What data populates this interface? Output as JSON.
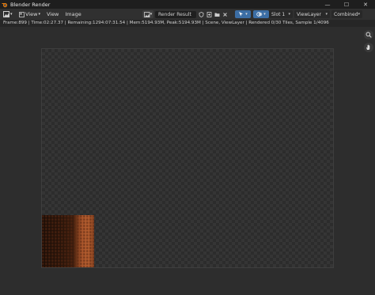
{
  "window": {
    "title": "Blender Render",
    "minimize_glyph": "—",
    "maximize_glyph": "☐",
    "close_glyph": "✕"
  },
  "header": {
    "menus": [
      {
        "label": "View"
      },
      {
        "label": "View"
      },
      {
        "label": "Image"
      }
    ],
    "image_name": "Render Result",
    "slot": "Slot 1",
    "view_layer": "ViewLayer",
    "pass": "Combined",
    "colors": {
      "accent": "#3c6ea5"
    }
  },
  "status": {
    "text": "Frame:899 | Time:02:27.37 | Remaining:1294:07:31.54 | Mem:5194.93M, Peak:5194.93M | Scene, ViewLayer | Rendered 0/30 Tiles, Sample 1/4096"
  },
  "icons": {
    "app": "blender-logo-icon",
    "editor_type": "image-editor-icon",
    "zoom": "zoom-icon",
    "pan": "hand-icon"
  }
}
